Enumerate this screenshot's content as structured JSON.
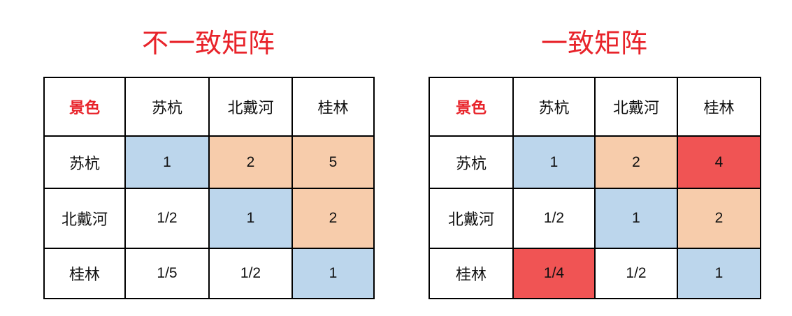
{
  "colors": {
    "title": "#e8232a",
    "corner": "#e8232a",
    "diagonal": "#bcd6ec",
    "upper": "#f7ccab",
    "inconsistent": "#f05454",
    "plain": "#ffffff"
  },
  "left": {
    "title": "不一致矩阵",
    "corner": "景色",
    "headers": [
      "苏杭",
      "北戴河",
      "桂林"
    ],
    "rows": [
      {
        "label": "苏杭",
        "cells": [
          {
            "value": "1",
            "tone": "diagonal"
          },
          {
            "value": "2",
            "tone": "upper"
          },
          {
            "value": "5",
            "tone": "upper"
          }
        ]
      },
      {
        "label": "北戴河",
        "cells": [
          {
            "value": "1/2",
            "tone": "plain"
          },
          {
            "value": "1",
            "tone": "diagonal"
          },
          {
            "value": "2",
            "tone": "upper"
          }
        ]
      },
      {
        "label": "桂林",
        "cells": [
          {
            "value": "1/5",
            "tone": "plain"
          },
          {
            "value": "1/2",
            "tone": "plain"
          },
          {
            "value": "1",
            "tone": "diagonal"
          }
        ]
      }
    ]
  },
  "right": {
    "title": "一致矩阵",
    "corner": "景色",
    "headers": [
      "苏杭",
      "北戴河",
      "桂林"
    ],
    "rows": [
      {
        "label": "苏杭",
        "cells": [
          {
            "value": "1",
            "tone": "diagonal"
          },
          {
            "value": "2",
            "tone": "upper"
          },
          {
            "value": "4",
            "tone": "inconsistent"
          }
        ]
      },
      {
        "label": "北戴河",
        "cells": [
          {
            "value": "1/2",
            "tone": "plain"
          },
          {
            "value": "1",
            "tone": "diagonal"
          },
          {
            "value": "2",
            "tone": "upper"
          }
        ]
      },
      {
        "label": "桂林",
        "cells": [
          {
            "value": "1/4",
            "tone": "inconsistent"
          },
          {
            "value": "1/2",
            "tone": "plain"
          },
          {
            "value": "1",
            "tone": "diagonal"
          }
        ]
      }
    ]
  }
}
